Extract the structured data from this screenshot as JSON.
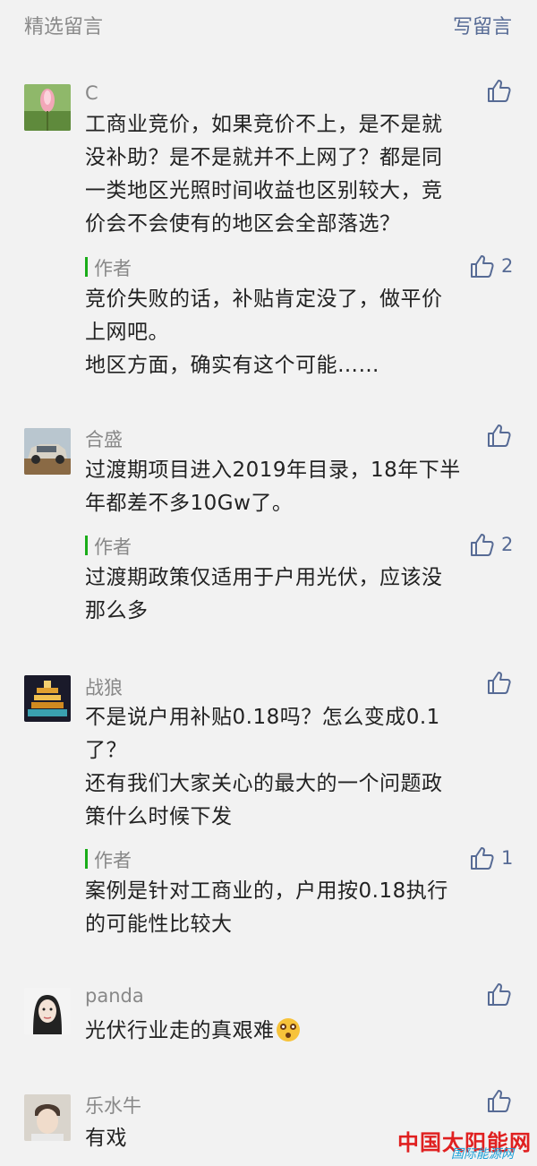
{
  "header": {
    "title": "精选留言",
    "write_label": "写留言"
  },
  "comments": [
    {
      "user": "C",
      "text": [
        "工商业竞价，如果竞价不上，是不是就",
        "没补助？是不是就并不上网了？都是同",
        "一类地区光照时间收益也区别较大，竞",
        "价会不会使有的地区会全部落选？"
      ],
      "reply": {
        "author": "作者",
        "likes": "2",
        "text": [
          "竞价失败的话，补贴肯定没了，做平价",
          "上网吧。",
          "地区方面，确实有这个可能……"
        ]
      }
    },
    {
      "user": "合盛",
      "text": [
        "过渡期项目进入2019年目录，18年下半",
        "年都差不多10Gw了。"
      ],
      "reply": {
        "author": "作者",
        "likes": "2",
        "text": [
          "过渡期政策仅适用于户用光伏，应该没",
          "那么多"
        ]
      }
    },
    {
      "user": "战狼",
      "text": [
        "不是说户用补贴0.18吗？怎么变成0.1",
        "了？",
        "还有我们大家关心的最大的一个问题政",
        "策什么时候下发"
      ],
      "reply": {
        "author": "作者",
        "likes": "1",
        "text": [
          "案例是针对工商业的，户用按0.18执行",
          "的可能性比较大"
        ]
      }
    },
    {
      "user": "panda",
      "text": [
        "光伏行业走的真艰难"
      ],
      "emoji": "flushed-face"
    },
    {
      "user": "乐水牛",
      "text": [
        "有戏"
      ]
    }
  ],
  "watermark": {
    "main": "中国太阳能网",
    "sub": "国际能源网"
  },
  "colors": {
    "background": "#f2f2f2",
    "link": "#576b95",
    "author_bar": "#1aad19",
    "watermark": "#e02020"
  }
}
